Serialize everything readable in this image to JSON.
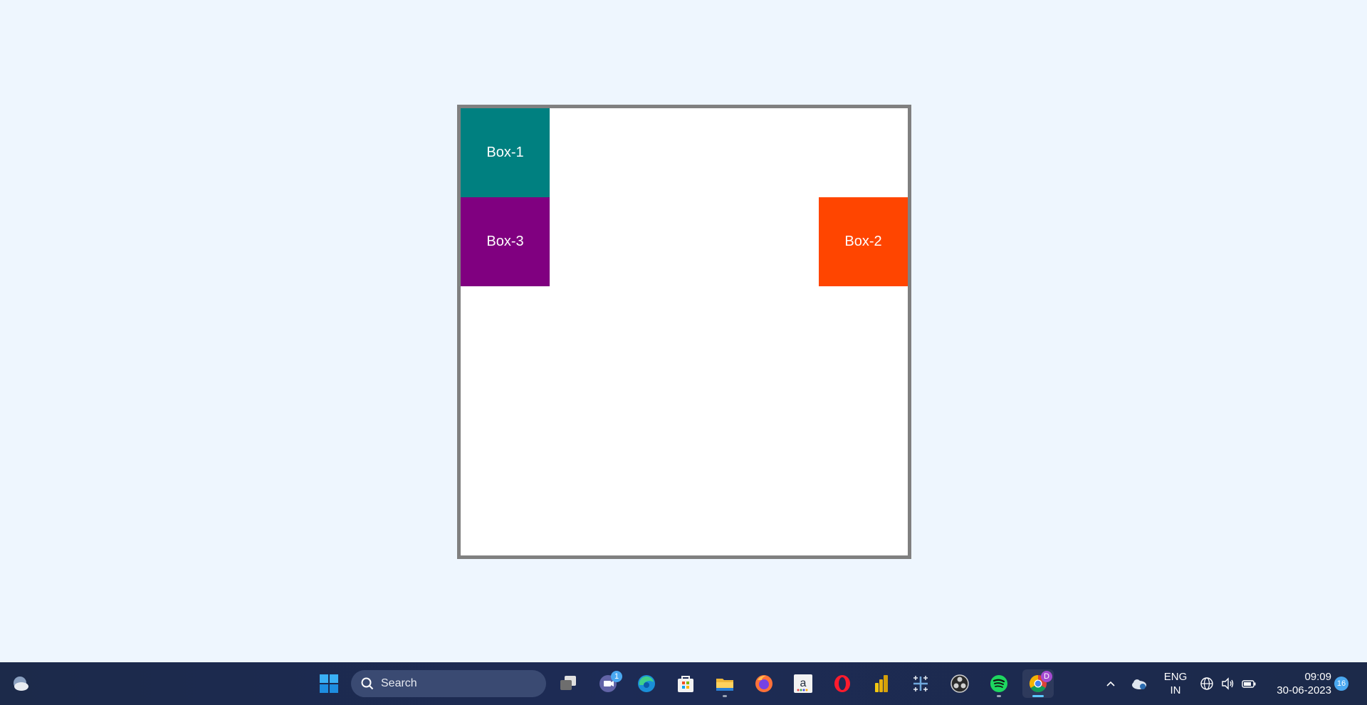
{
  "boxes": {
    "box1": {
      "label": "Box-1",
      "color": "#008080"
    },
    "box2": {
      "label": "Box-2",
      "color": "#ff4500"
    },
    "box3": {
      "label": "Box-3",
      "color": "#800080"
    }
  },
  "container": {
    "border_color": "#808080",
    "background": "#ffffff"
  },
  "taskbar": {
    "search_label": "Search",
    "apps": [
      {
        "name": "start-icon"
      },
      {
        "name": "task-view-icon"
      },
      {
        "name": "teams-meet-icon",
        "badge": "1"
      },
      {
        "name": "edge-icon"
      },
      {
        "name": "microsoft-store-icon"
      },
      {
        "name": "file-explorer-icon"
      },
      {
        "name": "firefox-icon"
      },
      {
        "name": "amazon-icon"
      },
      {
        "name": "opera-icon"
      },
      {
        "name": "power-bi-icon"
      },
      {
        "name": "tableau-icon"
      },
      {
        "name": "obs-icon"
      },
      {
        "name": "spotify-icon"
      },
      {
        "name": "chrome-icon",
        "badge": "D"
      }
    ],
    "tray": {
      "language_line1": "ENG",
      "language_line2": "IN",
      "time": "09:09",
      "date": "30-06-2023",
      "notification_count": "16"
    }
  }
}
